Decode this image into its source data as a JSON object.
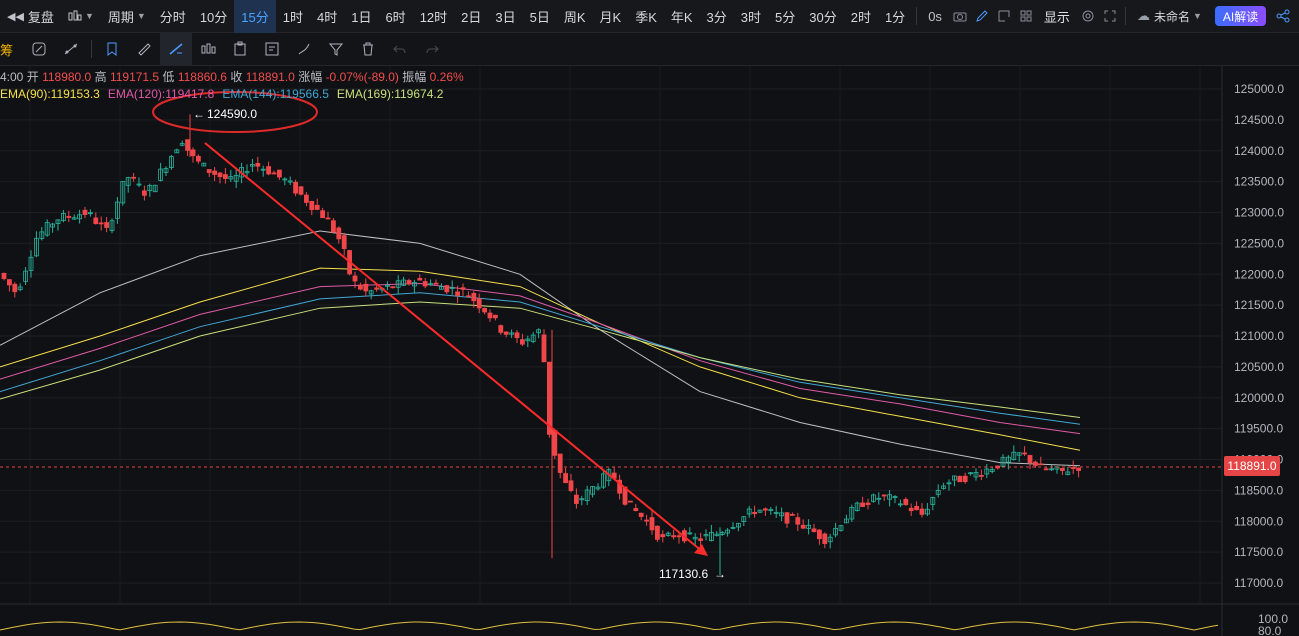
{
  "topbar": {
    "replay_label": "复盘",
    "period_label": "周期",
    "intervals": [
      "分时",
      "10分",
      "15分",
      "1时",
      "4时",
      "1日",
      "6时",
      "12时",
      "2日",
      "3日",
      "5日",
      "周K",
      "月K",
      "季K",
      "年K",
      "3分",
      "3时",
      "5分",
      "30分",
      "2时",
      "1分"
    ],
    "active_interval": "15分",
    "countdown": "0s",
    "display_label": "显示",
    "layout_name": "未命名",
    "ai_label": "AI解读"
  },
  "drawbar": {
    "label": "筹"
  },
  "ohlc": {
    "time": "4:00",
    "open_label": "开",
    "open": "118980.0",
    "high_label": "高",
    "high": "119171.5",
    "low_label": "低",
    "low": "118860.6",
    "close_label": "收",
    "close": "118891.0",
    "change_label": "涨幅",
    "change": "-0.07%(-89.0)",
    "amp_label": "振幅",
    "amp": "0.26%"
  },
  "indicators": [
    {
      "label": "EMA(90):119153.3",
      "color": "#f5e04a"
    },
    {
      "label": "EMA(120):119417.8",
      "color": "#e05aa8"
    },
    {
      "label": "EMA(144):119566.5",
      "color": "#3fa7d6"
    },
    {
      "label": "EMA(169):119674.2",
      "color": "#c7e07a"
    }
  ],
  "chart_data": {
    "type": "candlestick",
    "y_axis_labels": [
      "125000.0",
      "124500.0",
      "124000.0",
      "123500.0",
      "123000.0",
      "122500.0",
      "122000.0",
      "121500.0",
      "121000.0",
      "120500.0",
      "120000.0",
      "119500.0",
      "119000.0",
      "118500.0",
      "118000.0",
      "117500.0",
      "117000.0"
    ],
    "ylim": [
      116800,
      125300
    ],
    "current_price": "118891.0",
    "annotations": {
      "high": "124590.0",
      "low": "117130.6"
    },
    "sub_axis_labels": [
      "100.0",
      "80.0"
    ],
    "colors": {
      "up": "#26b39a",
      "down": "#f0464a",
      "trend": "#ff2a2a"
    }
  }
}
